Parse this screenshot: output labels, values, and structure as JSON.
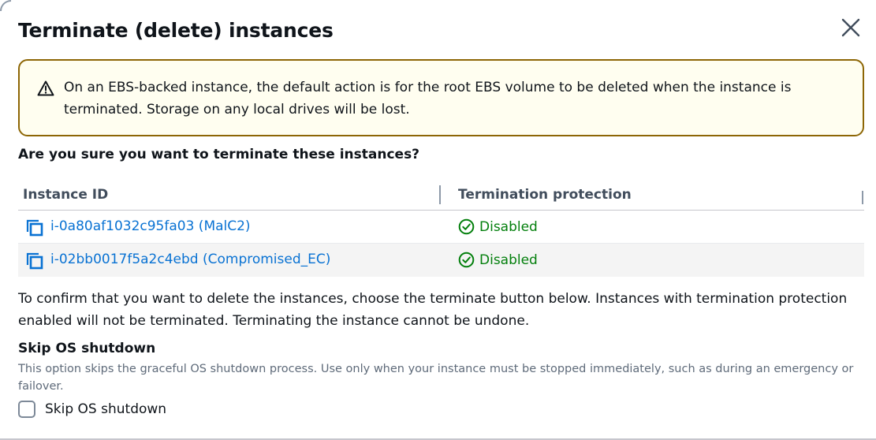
{
  "dialog": {
    "title": "Terminate (delete) instances",
    "close_icon": "close-icon"
  },
  "warning": {
    "icon": "warning-triangle-icon",
    "text": "On an EBS-backed instance, the default action is for the root EBS volume to be deleted when the instance is terminated. Storage on any local drives will be lost.",
    "border_color": "#8d6605",
    "background_color": "#fffef0"
  },
  "question": "Are you sure you want to terminate these instances?",
  "table": {
    "columns": [
      "Instance ID",
      "Termination protection"
    ],
    "rows": [
      {
        "instance": "i-0a80af1032c95fa03 (MalC2)",
        "protection": "Disabled"
      },
      {
        "instance": "i-02bb0017f5a2c4ebd (Compromised_EC)",
        "protection": "Disabled"
      }
    ],
    "link_color": "#0972d3",
    "status_color": "#037f0c"
  },
  "confirm_text": "To confirm that you want to delete the instances, choose the terminate button below. Instances with termination protection enabled will not be terminated. Terminating the instance cannot be undone.",
  "skip_os": {
    "heading": "Skip OS shutdown",
    "description": "This option skips the graceful OS shutdown process. Use only when your instance must be stopped immediately, such as during an emergency or failover.",
    "checkbox_label": "Skip OS shutdown",
    "checked": false
  }
}
